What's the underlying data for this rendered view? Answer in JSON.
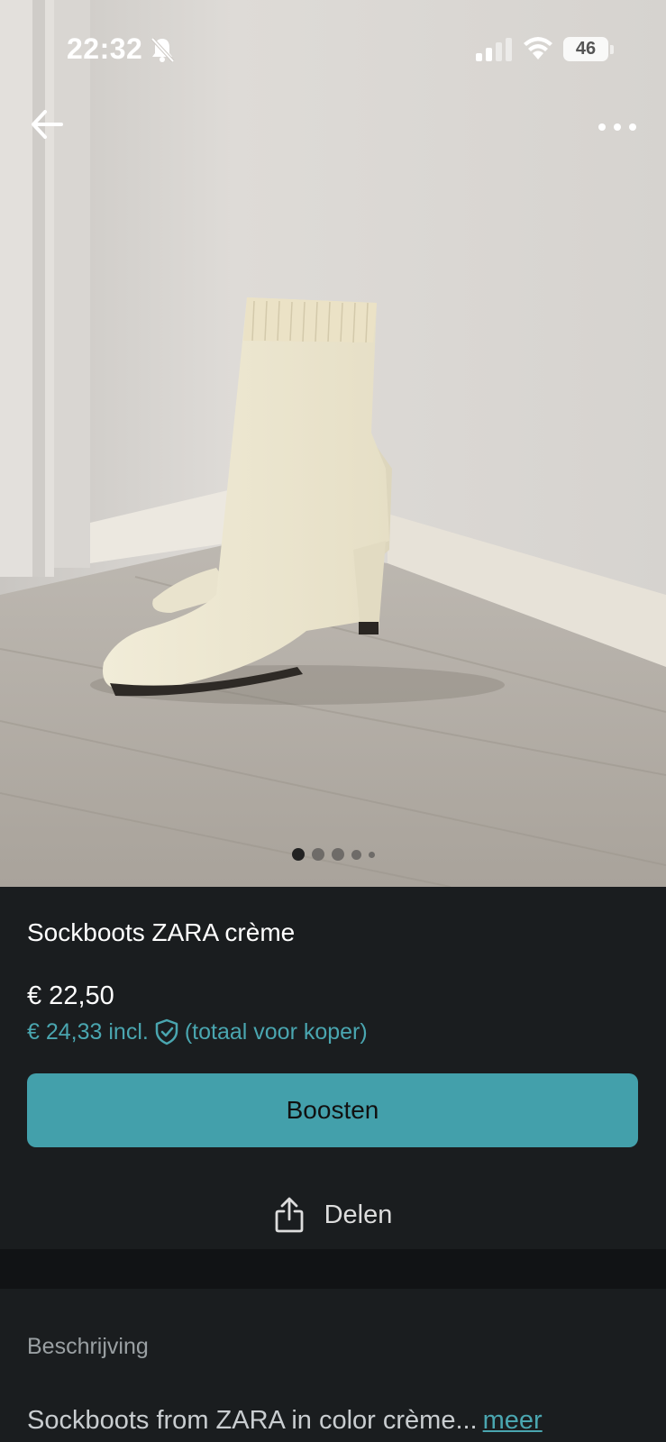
{
  "status_bar": {
    "time": "22:32",
    "battery": "46",
    "icons": [
      "bell-slash-icon",
      "signal-icon",
      "wifi-icon",
      "battery-icon"
    ]
  },
  "nav": {
    "back_icon": "arrow-left-icon",
    "more_icon": "more-horizontal-icon"
  },
  "gallery": {
    "image_count": 5,
    "active_index": 0
  },
  "listing": {
    "title": "Sockboots ZARA crème",
    "price": "€ 22,50",
    "price_incl": "€ 24,33 incl.",
    "buyer_total_note": "(totaal voor koper)"
  },
  "actions": {
    "boost_label": "Boosten",
    "share_label": "Delen"
  },
  "description": {
    "heading": "Beschrijving",
    "text": "Sockboots from ZARA in color crème...",
    "more_label": "meer"
  },
  "colors": {
    "accent": "#43a0ab",
    "accent_text": "#4aa6b0",
    "background": "#1a1d1f"
  }
}
